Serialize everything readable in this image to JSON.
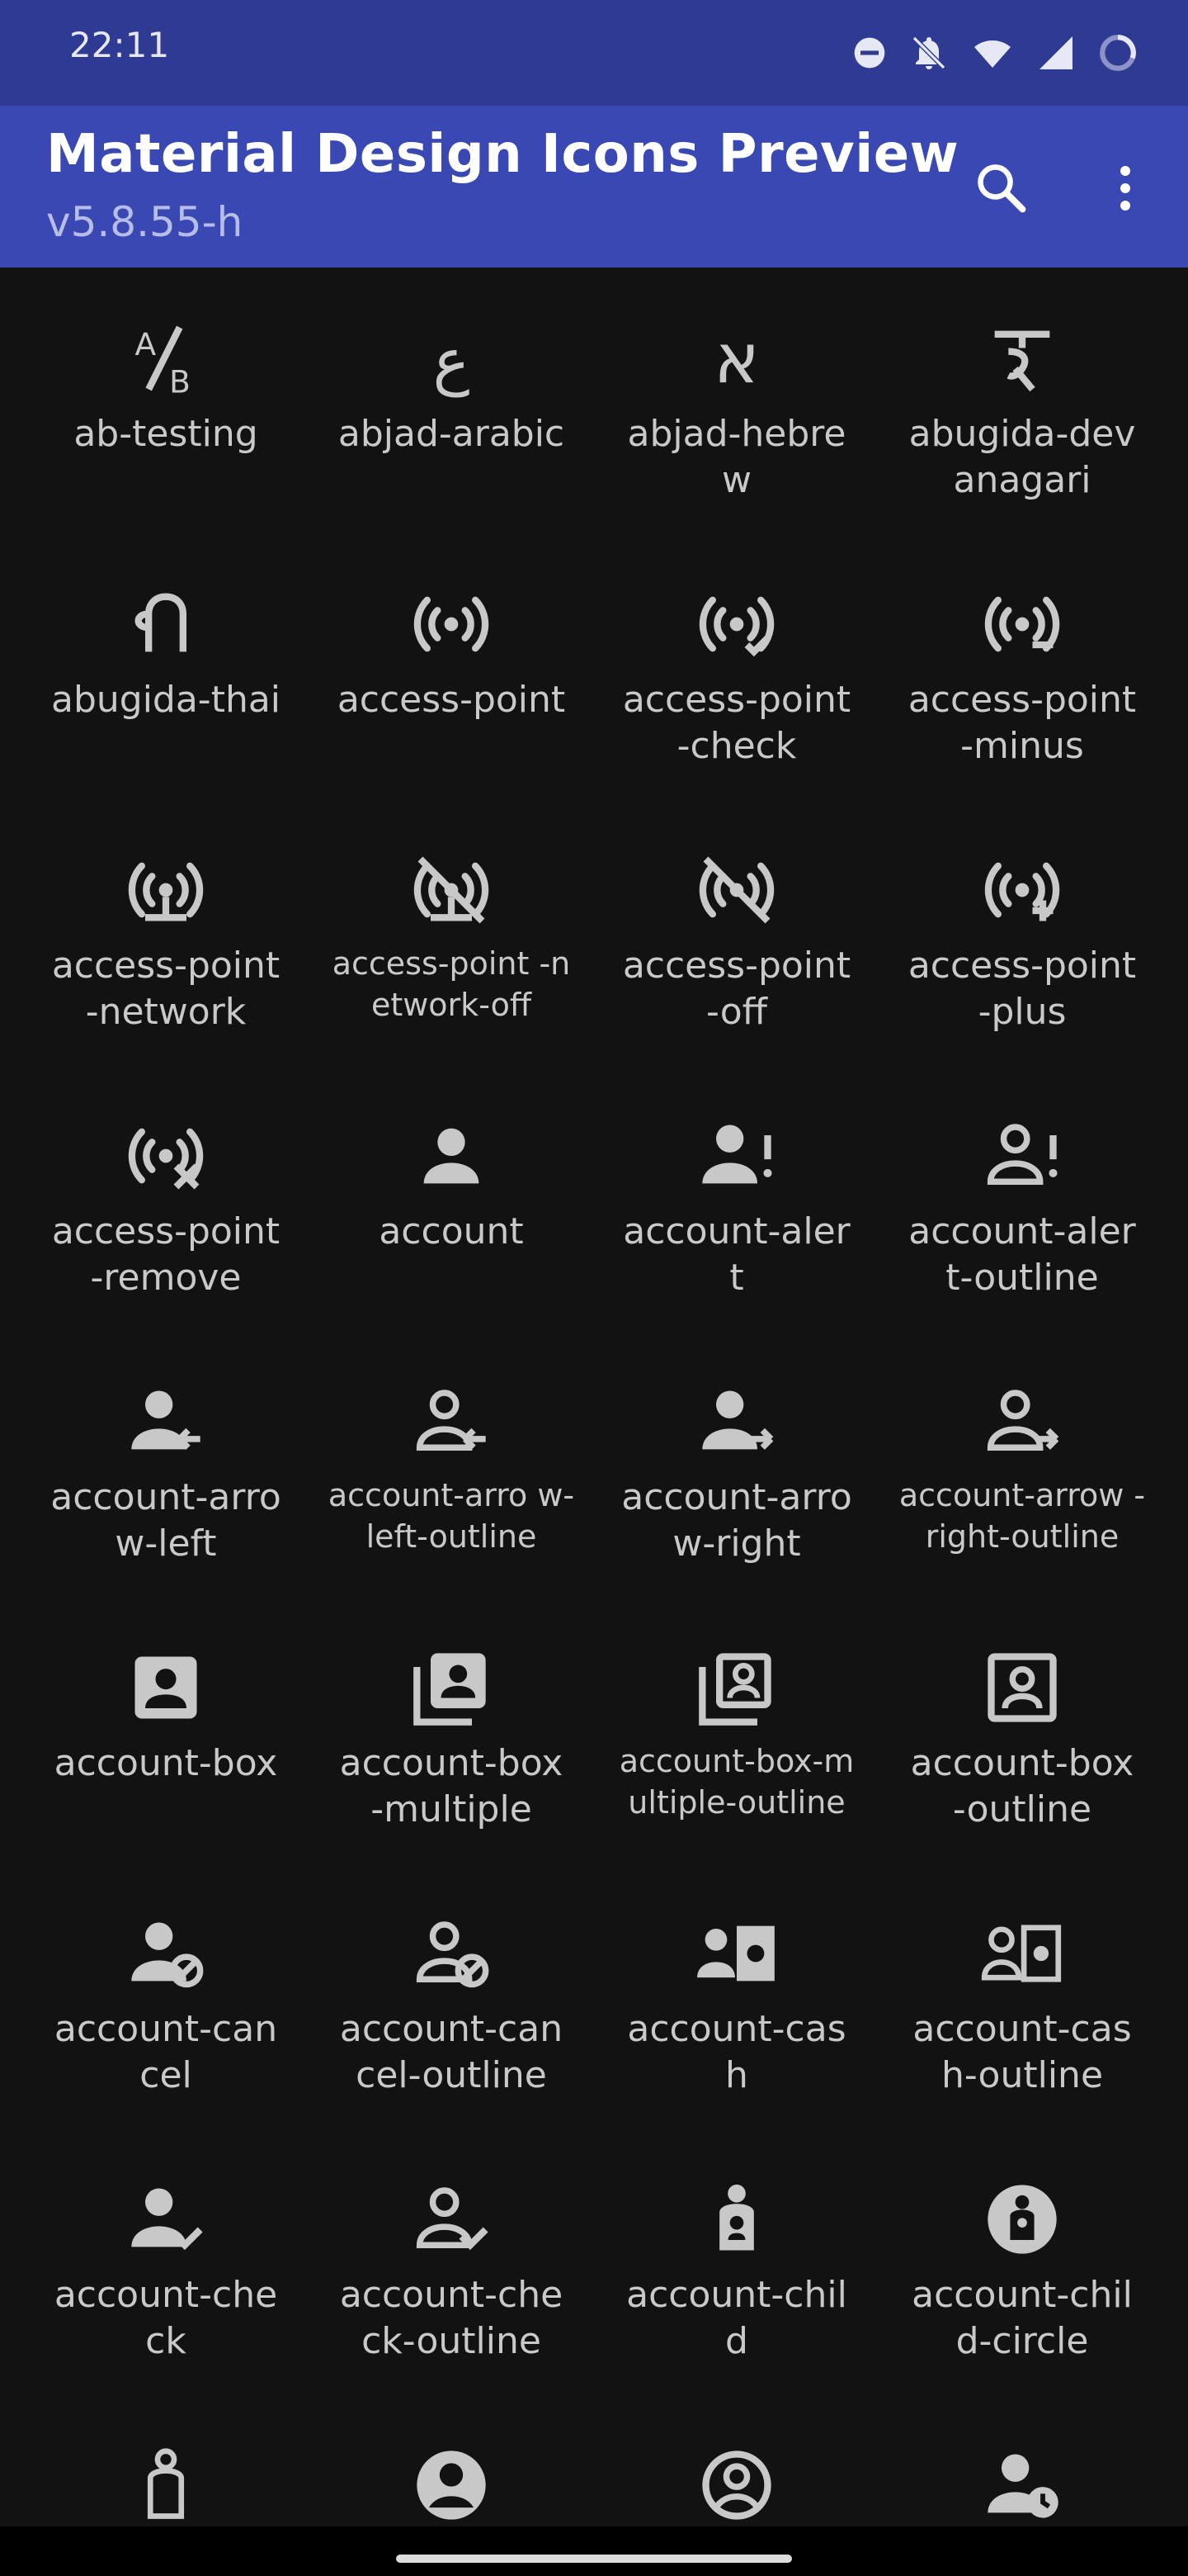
{
  "status": {
    "time": "22:11",
    "icons": [
      "dnd-icon",
      "bell-off-icon",
      "wifi-icon",
      "signal-icon",
      "battery-ring-icon"
    ]
  },
  "appbar": {
    "title": "Material Design Icons Preview",
    "subtitle": "v5.8.55-h",
    "search_icon": "search-icon",
    "menu_icon": "more-vert-icon"
  },
  "colors": {
    "status_bar": "#2f3b93",
    "app_bar": "#3a48b4",
    "background": "#121212",
    "icon": "#c8c8c8",
    "label": "#c9c9c9"
  },
  "icons": [
    {
      "name": "ab-testing",
      "label": "ab-testing"
    },
    {
      "name": "abjad-arabic",
      "label": "abjad-arabic"
    },
    {
      "name": "abjad-hebrew",
      "label": "abjad-hebre w"
    },
    {
      "name": "abugida-devanagari",
      "label": "abugida-dev anagari"
    },
    {
      "name": "abugida-thai",
      "label": "abugida-thai"
    },
    {
      "name": "access-point",
      "label": "access-point"
    },
    {
      "name": "access-point-check",
      "label": "access-point -check"
    },
    {
      "name": "access-point-minus",
      "label": "access-point -minus"
    },
    {
      "name": "access-point-network",
      "label": "access-point -network"
    },
    {
      "name": "access-point-network-off",
      "label": "access-point -network-off"
    },
    {
      "name": "access-point-off",
      "label": "access-point -off"
    },
    {
      "name": "access-point-plus",
      "label": "access-point -plus"
    },
    {
      "name": "access-point-remove",
      "label": "access-point -remove"
    },
    {
      "name": "account",
      "label": "account"
    },
    {
      "name": "account-alert",
      "label": "account-aler t"
    },
    {
      "name": "account-alert-outline",
      "label": "account-aler t-outline"
    },
    {
      "name": "account-arrow-left",
      "label": "account-arro w-left"
    },
    {
      "name": "account-arrow-left-outline",
      "label": "account-arro w-left-outline"
    },
    {
      "name": "account-arrow-right",
      "label": "account-arro w-right"
    },
    {
      "name": "account-arrow-right-outline",
      "label": "account-arrow -right-outline"
    },
    {
      "name": "account-box",
      "label": "account-box"
    },
    {
      "name": "account-box-multiple",
      "label": "account-box -multiple"
    },
    {
      "name": "account-box-multiple-outline",
      "label": "account-box-m ultiple-outline"
    },
    {
      "name": "account-box-outline",
      "label": "account-box -outline"
    },
    {
      "name": "account-cancel",
      "label": "account-can cel"
    },
    {
      "name": "account-cancel-outline",
      "label": "account-can cel-outline"
    },
    {
      "name": "account-cash",
      "label": "account-cas h"
    },
    {
      "name": "account-cash-outline",
      "label": "account-cas h-outline"
    },
    {
      "name": "account-check",
      "label": "account-che ck"
    },
    {
      "name": "account-check-outline",
      "label": "account-che ck-outline"
    },
    {
      "name": "account-child",
      "label": "account-chil d"
    },
    {
      "name": "account-child-circle",
      "label": "account-chil d-circle"
    },
    {
      "name": "account-child-outline",
      "label": ""
    },
    {
      "name": "account-circle",
      "label": ""
    },
    {
      "name": "account-circle-outline",
      "label": ""
    },
    {
      "name": "account-clock",
      "label": ""
    }
  ]
}
